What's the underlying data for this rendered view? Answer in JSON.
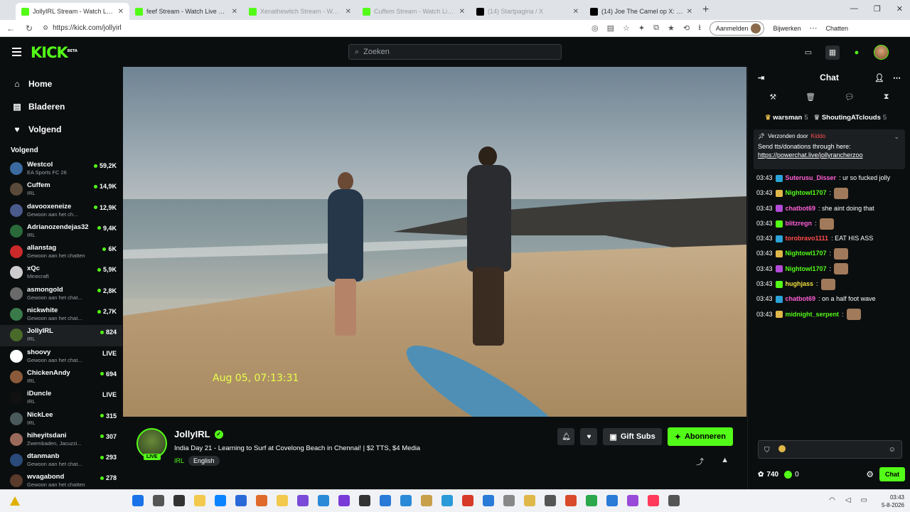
{
  "browser": {
    "tabs": [
      {
        "title": "JollyIRL Stream - Watch Live o",
        "active": true,
        "favicon_color": "#53fc18"
      },
      {
        "title": "feef Stream - Watch Live on Kick",
        "active": false,
        "favicon_color": "#53fc18"
      },
      {
        "title": "Xenathewitch Stream - Watch Liv",
        "active": false,
        "favicon_color": "#53fc18"
      },
      {
        "title": "Cuffem Stream - Watch Live on Ki",
        "active": false,
        "favicon_color": "#53fc18"
      },
      {
        "title": "(14) Startpagina / X",
        "active": false,
        "favicon_color": "#000000"
      },
      {
        "title": "(14) Joe The Camel op X: 'Sam Pe",
        "active": false,
        "favicon_color": "#000000"
      }
    ],
    "url": "https://kick.com/jollyirl",
    "signin_label": "Aanmelden",
    "edit_label": "Bijwerken",
    "chat_label": "Chatten"
  },
  "kick": {
    "logo": "KICK",
    "logo_sup": "BETA",
    "search_placeholder": "Zoeken",
    "accent_color": "#53fc18"
  },
  "sidebar": {
    "nav": [
      {
        "label": "Home",
        "icon": "home-icon"
      },
      {
        "label": "Bladeren",
        "icon": "browse-icon"
      },
      {
        "label": "Volgend",
        "icon": "heart-icon"
      }
    ],
    "following_header": "Volgend",
    "channels": [
      {
        "name": "Westcol",
        "category": "EA Sports FC 26",
        "viewers": "59,2K",
        "live_label": false,
        "avatar_color": "#3a6aa0"
      },
      {
        "name": "Cuffem",
        "category": "IRL",
        "viewers": "14,9K",
        "live_label": false,
        "avatar_color": "#5a4a3a"
      },
      {
        "name": "davooxeneize",
        "category": "Gewoon aan het ch...",
        "viewers": "12,9K",
        "live_label": false,
        "avatar_color": "#4a5a8a"
      },
      {
        "name": "Adrianozendejas32",
        "category": "IRL",
        "viewers": "9,4K",
        "live_label": false,
        "avatar_color": "#2a6a3a"
      },
      {
        "name": "allanstag",
        "category": "Gewoon aan het chatten",
        "viewers": "6K",
        "live_label": false,
        "avatar_color": "#cc2a2a"
      },
      {
        "name": "xQc",
        "category": "Minecraft",
        "viewers": "5,9K",
        "live_label": false,
        "avatar_color": "#cccccc"
      },
      {
        "name": "asmongold",
        "category": "Gewoon aan het chat...",
        "viewers": "2,8K",
        "live_label": false,
        "avatar_color": "#6a6a6a"
      },
      {
        "name": "nickwhite",
        "category": "Gewoon aan het chat...",
        "viewers": "2,7K",
        "live_label": false,
        "avatar_color": "#3a7a4a"
      },
      {
        "name": "JollyIRL",
        "category": "IRL",
        "viewers": "824",
        "live_label": false,
        "avatar_color": "#4a6a2a"
      },
      {
        "name": "shoovy",
        "category": "Gewoon aan het chat...",
        "viewers": "LIVE",
        "live_label": true,
        "avatar_color": "#ffffff"
      },
      {
        "name": "ChickenAndy",
        "category": "IRL",
        "viewers": "694",
        "live_label": false,
        "avatar_color": "#8a5a3a"
      },
      {
        "name": "iDuncle",
        "category": "IRL",
        "viewers": "LIVE",
        "live_label": true,
        "avatar_color": "#111111"
      },
      {
        "name": "NickLee",
        "category": "IRL",
        "viewers": "315",
        "live_label": false,
        "avatar_color": "#4a5a5a"
      },
      {
        "name": "hiheyitsdani",
        "category": "Zwembaden, Jacuzzi...",
        "viewers": "307",
        "live_label": false,
        "avatar_color": "#9a6a5a"
      },
      {
        "name": "dtanmanb",
        "category": "Gewoon aan het chat...",
        "viewers": "293",
        "live_label": false,
        "avatar_color": "#2a4a7a"
      },
      {
        "name": "wvagabond",
        "category": "Gewoon aan het chatten",
        "viewers": "278",
        "live_label": false,
        "avatar_color": "#5a3a2a"
      }
    ]
  },
  "video": {
    "timestamp_overlay": "Aug 05, 07:13:31"
  },
  "stream": {
    "name": "JollyIRL",
    "live_badge": "LIVE",
    "title": "India Day 21 - Learning to Surf at Covelong Beach in Chennai! | $2 TTS, $4 Media",
    "category": "IRL",
    "language": "English",
    "gift_label": "Gift Subs",
    "subscribe_label": "Abonneren"
  },
  "chat": {
    "title": "Chat",
    "gifters": [
      {
        "name": "warsman",
        "count": "5"
      },
      {
        "name": "ShoutingATclouds",
        "count": "5"
      }
    ],
    "pinned": {
      "sent_by_label": "Verzonden door",
      "sender": "Kiddo",
      "text": "Send tts/donations through here:",
      "link": "https://powerchat.live/jollyrancherzoo"
    },
    "messages": [
      {
        "time": "03:43",
        "user": "Suterusu_Disser",
        "color": "#ff5fd7",
        "text": ": ur so fucked jolly",
        "emote": false
      },
      {
        "time": "03:43",
        "user": "Nightowl1707",
        "color": "#53fc18",
        "text": ":",
        "emote": true
      },
      {
        "time": "03:43",
        "user": "chatbot69",
        "color": "#ff5fd7",
        "text": ": she aint doing that",
        "emote": false
      },
      {
        "time": "03:43",
        "user": "blitzregn",
        "color": "#ff5fd7",
        "text": ":",
        "emote": true
      },
      {
        "time": "03:43",
        "user": "torobravo1111",
        "color": "#ff4d4d",
        "text": ": EAT HIS ASS",
        "emote": false
      },
      {
        "time": "03:43",
        "user": "Nightowl1707",
        "color": "#53fc18",
        "text": ":",
        "emote": true
      },
      {
        "time": "03:43",
        "user": "Nightowl1707",
        "color": "#53fc18",
        "text": ":",
        "emote": true
      },
      {
        "time": "03:43",
        "user": "hughjass",
        "color": "#f0e040",
        "text": ":",
        "emote": true
      },
      {
        "time": "03:43",
        "user": "chatbot69",
        "color": "#ff5fd7",
        "text": ": on a half foot wave",
        "emote": false
      },
      {
        "time": "03:43",
        "user": "midnight_serpent",
        "color": "#53fc18",
        "text": ":",
        "emote": true
      }
    ],
    "points": "740",
    "kick_points": "0",
    "chat_button": "Chat"
  },
  "taskbar": {
    "time": "03:43",
    "date": "5-8-2026"
  }
}
